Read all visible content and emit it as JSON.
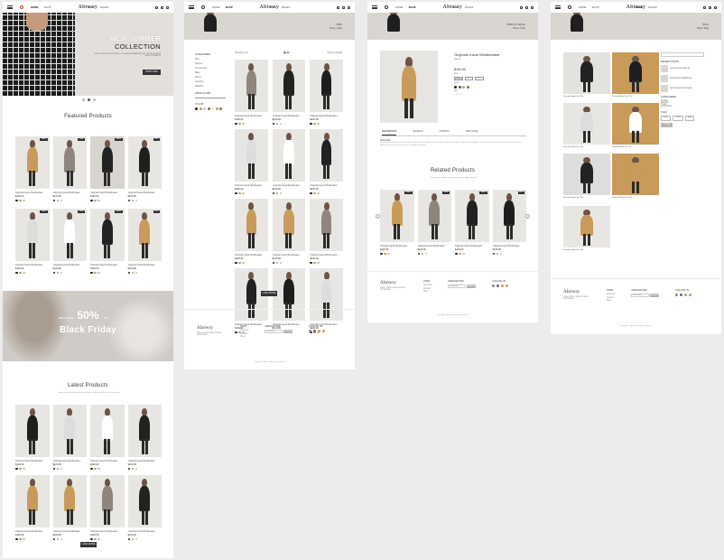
{
  "brand": "Abreoy",
  "nav": [
    "HOME",
    "SHOP",
    "BLOG",
    "PAGES",
    "CONTACT"
  ],
  "home": {
    "hero_title_1": "NEW SUMMER",
    "hero_title_2": "COLLECTION",
    "hero_text": "Lorem ipsum dolor sit amet, consectetur adipisicing elit, sed do eiusmod tempor incididunt",
    "hero_button": "SHOP NOW",
    "featured_title": "Featured Products",
    "promo_pre": "Black Friday",
    "promo_pct": "50%",
    "promo_off": "OFF",
    "promo_title": "Black Friday",
    "latest_title": "Latest Products",
    "latest_sub": "Lorem ipsum dolor sit amet consectetur adipisicing elit sed do eiusmod",
    "load_more": "LOAD MORE",
    "product_name": "Originals Kaval Windbreaker",
    "product_price": "$120.00",
    "badges": [
      "SALE",
      "NEW",
      "SALE",
      "HOT"
    ]
  },
  "shop": {
    "breadcrumb_1": "SHOP",
    "breadcrumb_2": "Home / Shop",
    "filter_title": "CATEGORIES",
    "categories": [
      "Men",
      "Women",
      "Accessories",
      "Bags",
      "Shoes",
      "Jewellery",
      "Watches"
    ],
    "price_title": "PRICE FILTER",
    "color_title": "COLOR",
    "sort_label": "Showing 1-12",
    "sort_by": "Sort by: Default",
    "load_more": "LOAD MORE"
  },
  "detail": {
    "breadcrumb_1": "PRODUCT DETAIL",
    "breadcrumb_2": "Home / Shop",
    "title": "Originals Kaval Windbreaker",
    "subtitle": "Jacket",
    "price": "$120.00",
    "size_label": "Size",
    "sizes": [
      "S",
      "M",
      "L"
    ],
    "color_label": "Color",
    "qty_label": "Qty",
    "tabs": [
      "DESCRIPTION",
      "REVIEWS",
      "SHIPPING",
      "SIZE GUIDE"
    ],
    "desc_title": "Description",
    "desc": "Lorem ipsum dolor sit amet, consectetur adipisicing elit, sed do eiusmod tempor incididunt ut labore et dolore magna aliqua. Ut enim ad minim veniam, quis nostrud exercitation ullamco laboris nisi ut aliquip ex ea commodo consequat.",
    "related_title": "Related Products",
    "related_sub": "Lorem ipsum dolor sit amet consectetur adipisicing elit"
  },
  "blog": {
    "breadcrumb_1": "BLOG",
    "breadcrumb_2": "Home / Blog",
    "caption": "Fashion Blog Post Title",
    "search_label": "SEARCH",
    "recent_label": "RECENT POSTS",
    "recent": [
      "Lorem ipsum dolor sit",
      "Consectetur adipisicing",
      "Sed do eiusmod tempor"
    ],
    "categories_label": "CATEGORIES",
    "categories": [
      "Fashion",
      "Lifestyle",
      "Travel",
      "Accessories"
    ],
    "tags_label": "TAGS",
    "tags": [
      "Dress",
      "Shoes",
      "Bags",
      "Fashion"
    ]
  },
  "footer": {
    "about": "Lorem ipsum dolor sit amet consectetur",
    "links_title": "LINKS",
    "links": [
      "About Us",
      "Contact",
      "Shop",
      "Blog"
    ],
    "news_title": "NEWSLETTER",
    "news_placeholder": "Your email",
    "news_button": "SUBSCRIBE",
    "social_title": "FOLLOW US",
    "copyright": "Copyright © Abreoy. All rights reserved."
  },
  "colors": {
    "accent": "#c89b5a",
    "dark": "#333333",
    "swatches": [
      "#222222",
      "#c89b5a",
      "#c9c2bb",
      "#8b6f5a",
      "#e8e8e8"
    ]
  }
}
